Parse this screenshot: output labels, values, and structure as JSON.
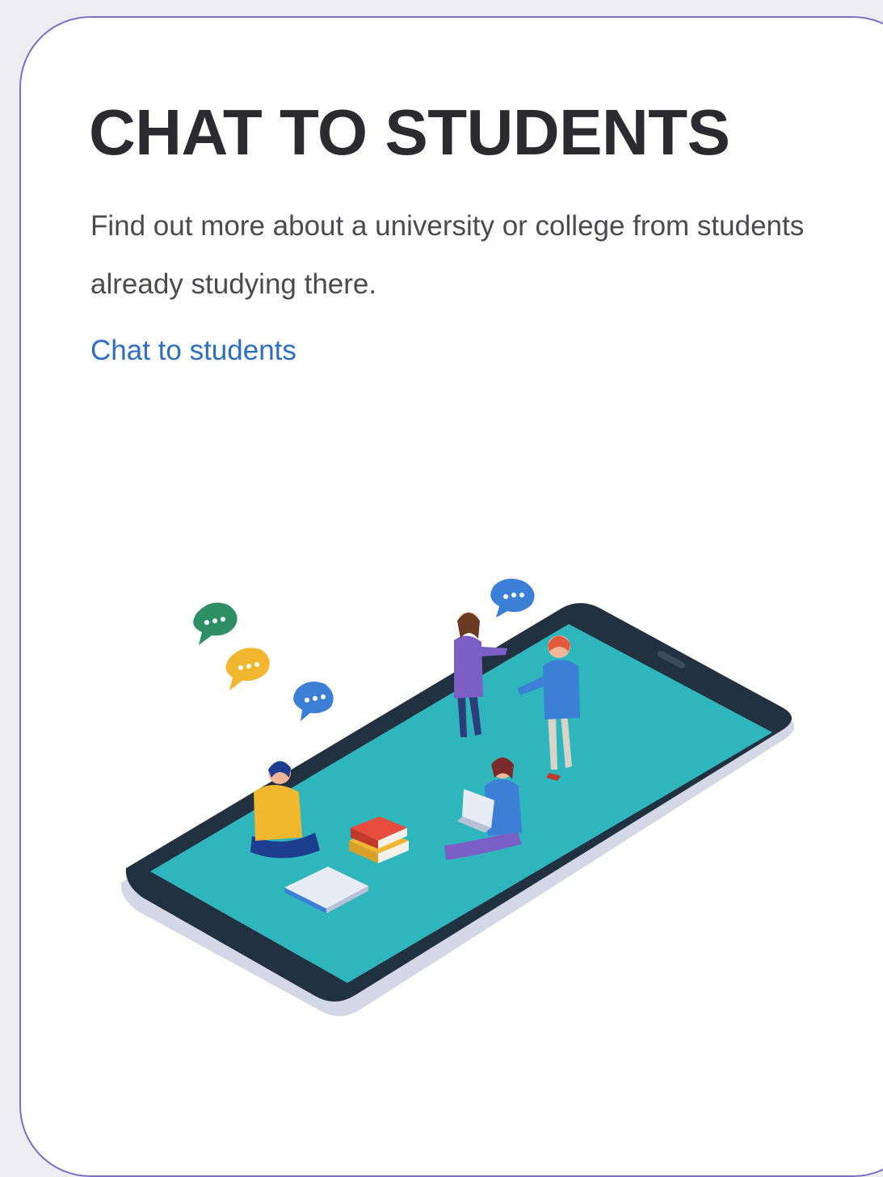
{
  "card": {
    "title": "CHAT TO STUDENTS",
    "description": "Find out more about a university or college from students already studying there.",
    "link_label": "Chat to students"
  },
  "illustration": {
    "icons": [
      "smartphone-icon",
      "chat-bubble-icon",
      "student-figure-icon",
      "book-icon",
      "laptop-icon"
    ]
  },
  "colors": {
    "title": "#2b2b2f",
    "body_text": "#4a4a50",
    "link": "#2d6fbf",
    "card_border": "#7f6fc4",
    "phone_screen": "#2fb6bd",
    "phone_frame": "#22313f"
  }
}
